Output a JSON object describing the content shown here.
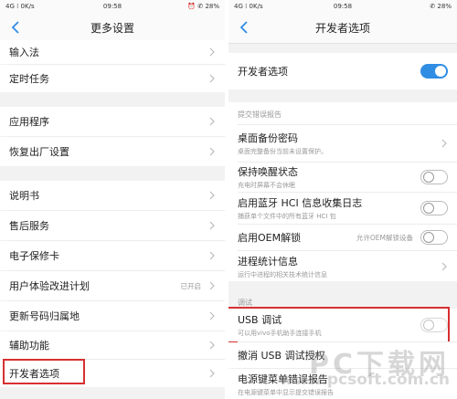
{
  "left": {
    "status": {
      "signal": "4G ⁞ 0K/s",
      "time": "09:58",
      "battery": "⏰ ✆ 28%"
    },
    "title": "更多设置",
    "items": [
      {
        "label": "输入法"
      },
      {
        "label": "定时任务"
      },
      {
        "label": "应用程序"
      },
      {
        "label": "恢复出厂设置"
      },
      {
        "label": "说明书"
      },
      {
        "label": "售后服务"
      },
      {
        "label": "电子保修卡"
      },
      {
        "label": "用户体验改进计划",
        "value": "已开启"
      },
      {
        "label": "更新号码归属地"
      },
      {
        "label": "辅助功能"
      },
      {
        "label": "开发者选项"
      }
    ]
  },
  "right": {
    "status": {
      "signal": "4G ⁞ 0K/s",
      "time": "09:58",
      "battery": "✆ 28%"
    },
    "title": "开发者选项",
    "master": {
      "label": "开发者选项",
      "on": true
    },
    "section_bug": "提交错误报告",
    "items": [
      {
        "label": "桌面备份密码",
        "sub": "桌面完整备份当前未设置保护。"
      },
      {
        "label": "保持唤醒状态",
        "sub": "充电时屏幕不会休眠",
        "toggle": false
      },
      {
        "label": "启用蓝牙 HCI 信息收集日志",
        "sub": "捕获单个文件中的所有蓝牙 HCI 包",
        "toggle": false
      },
      {
        "label": "启用OEM解锁",
        "value": "允许OEM解锁设备",
        "toggle": false
      },
      {
        "label": "进程统计信息",
        "sub": "运行中进程的相关技术统计信息"
      }
    ],
    "section_debug": "调试",
    "usb": {
      "label": "USB 调试",
      "sub": "可以用vivo手机助手连接手机",
      "toggle": false
    },
    "revoke": {
      "label": "撤消 USB 调试授权"
    },
    "power": {
      "label": "电源键菜单错误报告",
      "sub": "在电源键菜单中显示提交错误报告"
    }
  },
  "watermark": {
    "text": "PC下载网",
    "url": "www.pcsoft.com.cn"
  },
  "colors": {
    "accent": "#2f8de4",
    "highlight": "#d63030"
  }
}
